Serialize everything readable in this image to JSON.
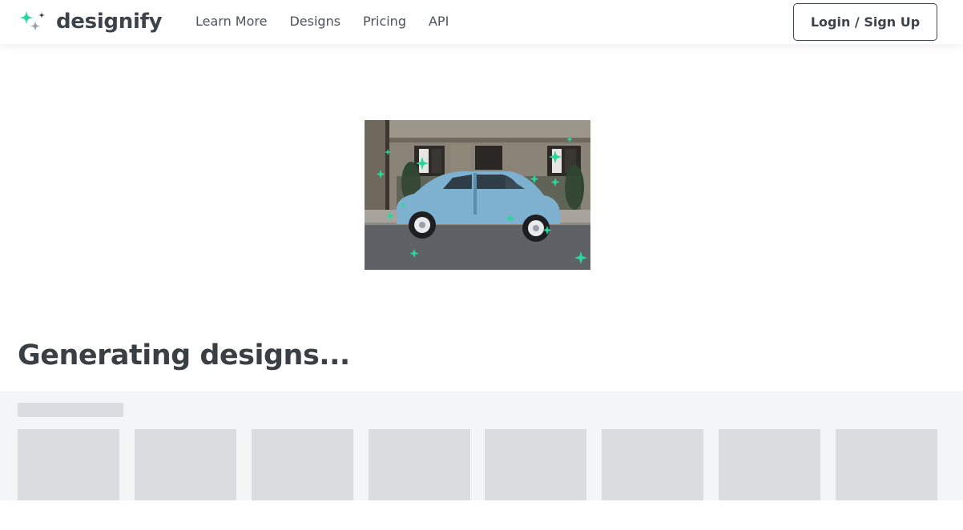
{
  "brand": {
    "name": "designify",
    "accent_color": "#2bd69b",
    "secondary_color": "#9aa1a8"
  },
  "nav": {
    "items": [
      {
        "label": "Learn More"
      },
      {
        "label": "Designs"
      },
      {
        "label": "Pricing"
      },
      {
        "label": "API"
      }
    ]
  },
  "header": {
    "login_label": "Login / Sign Up"
  },
  "main": {
    "preview_image": "blue-car-photo",
    "status_heading": "Generating designs..."
  },
  "results": {
    "placeholder_count": 8
  }
}
